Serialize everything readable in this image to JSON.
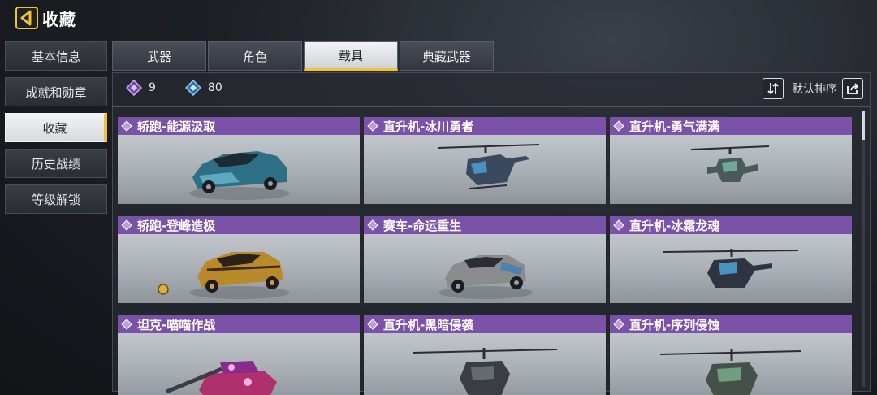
{
  "header": {
    "title": "收藏"
  },
  "sidebar": {
    "items": [
      {
        "label": "基本信息"
      },
      {
        "label": "成就和勋章"
      },
      {
        "label": "收藏"
      },
      {
        "label": "历史战绩"
      },
      {
        "label": "等级解锁"
      }
    ],
    "active_index": 2
  },
  "tabs": [
    {
      "label": "武器"
    },
    {
      "label": "角色"
    },
    {
      "label": "载具"
    },
    {
      "label": "典藏武器"
    }
  ],
  "active_tab": 2,
  "counts": [
    {
      "icon": "purple-diamond-icon",
      "value": "9"
    },
    {
      "icon": "blue-diamond-icon",
      "value": "80"
    }
  ],
  "sort": {
    "label": "默认排序"
  },
  "colors": {
    "accent": "#f2c230",
    "rarity_purple": "#7a53a8"
  },
  "vehicles": [
    {
      "name": "轿跑-能源汲取",
      "kind": "car",
      "color": "#2f6f86"
    },
    {
      "name": "直升机-冰川勇者",
      "kind": "heli",
      "color": "#3a4a5e"
    },
    {
      "name": "直升机-勇气满满",
      "kind": "heli",
      "color": "#4a5a58"
    },
    {
      "name": "轿跑-登峰造极",
      "kind": "car",
      "color": "#b98a2a"
    },
    {
      "name": "赛车-命运重生",
      "kind": "car",
      "color": "#8a8c8e"
    },
    {
      "name": "直升机-冰霜龙魂",
      "kind": "heli",
      "color": "#2e3440"
    },
    {
      "name": "坦克-喵喵作战",
      "kind": "tank",
      "color": "#b0306e"
    },
    {
      "name": "直升机-黑暗侵袭",
      "kind": "heli",
      "color": "#3a3d44"
    },
    {
      "name": "直升机-序列侵蚀",
      "kind": "heli",
      "color": "#445048"
    }
  ]
}
